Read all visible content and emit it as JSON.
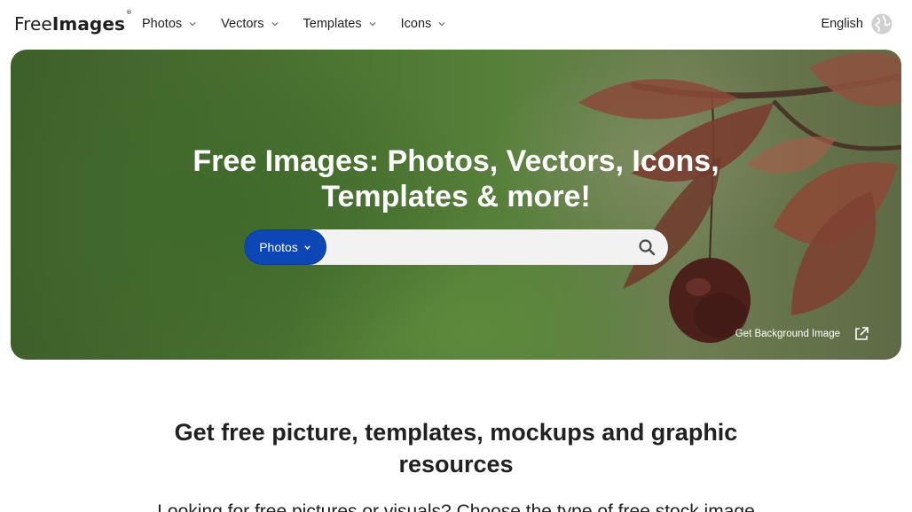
{
  "brand": {
    "logo_light": "Free",
    "logo_bold": "Images",
    "logo_mark": "®"
  },
  "nav": {
    "items": [
      {
        "label": "Photos"
      },
      {
        "label": "Vectors"
      },
      {
        "label": "Templates"
      },
      {
        "label": "Icons"
      }
    ],
    "language": "English"
  },
  "hero": {
    "title_line1": "Free Images: Photos, Vectors, Icons,",
    "title_line2": "Templates & more!",
    "search": {
      "type_selected": "Photos",
      "placeholder": ""
    },
    "background_link": "Get Background Image"
  },
  "content": {
    "heading_line1": "Get free picture, templates, mockups and graphic",
    "heading_line2": "resources",
    "intro": "Looking for free pictures or visuals? Choose the type of free stock image"
  },
  "colors": {
    "accent": "#0d47b5",
    "text": "#212121",
    "search_bg": "#f2f2f2"
  },
  "icons": {
    "nav_dropdown": "chevron-down-icon",
    "language": "globe-icon",
    "search": "search-icon",
    "external": "external-link-icon"
  }
}
